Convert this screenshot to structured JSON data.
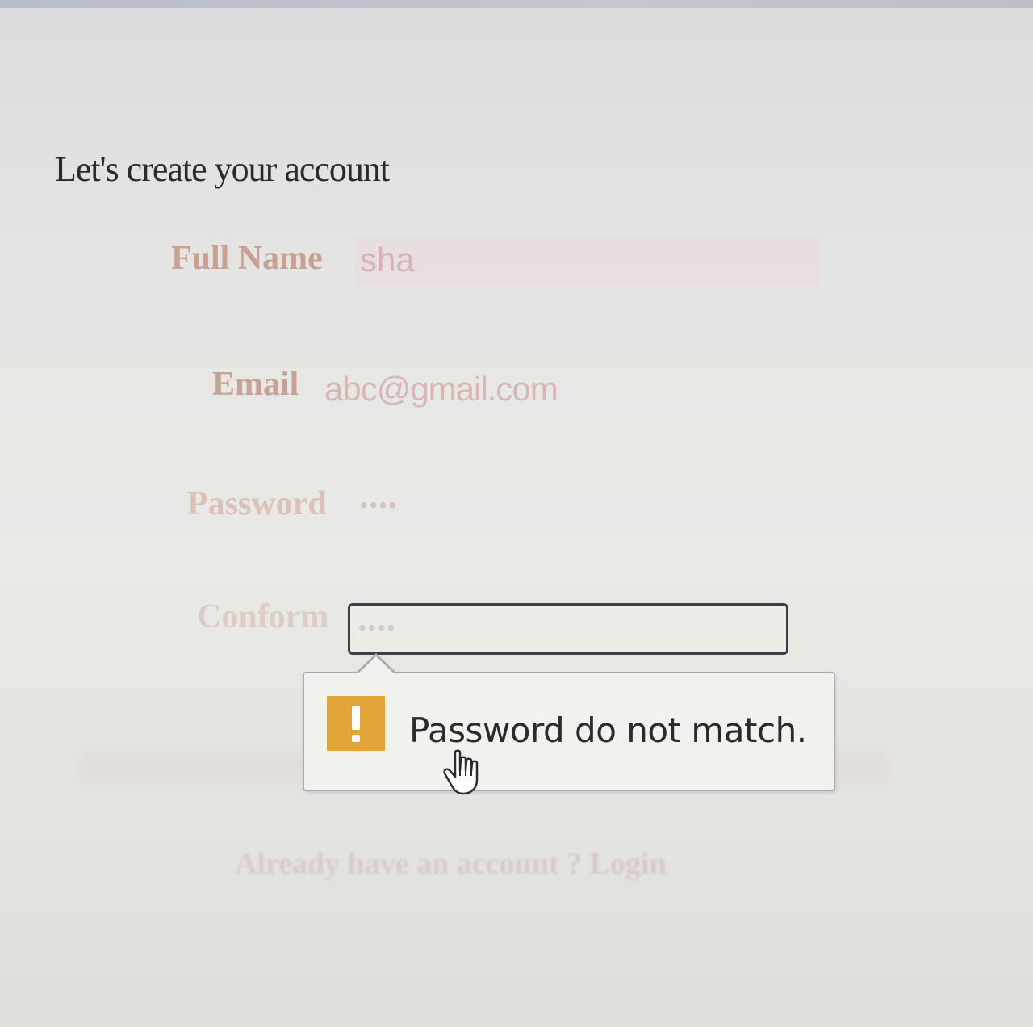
{
  "form": {
    "title": "Let's create your account",
    "full_name": {
      "label": "Full Name",
      "value": "sha"
    },
    "email": {
      "label": "Email",
      "value": "abc@gmail.com"
    },
    "password": {
      "label": "Password",
      "value": "••••"
    },
    "confirm": {
      "label": "Conform",
      "value": "••••"
    }
  },
  "validation": {
    "message": "Password do not match.",
    "icon": "warning-exclamation-icon",
    "icon_color": "#e3a43a"
  },
  "footer": {
    "prompt": "Already have an account ?",
    "login_link": "Login"
  },
  "cursor": "hand-pointer-icon"
}
